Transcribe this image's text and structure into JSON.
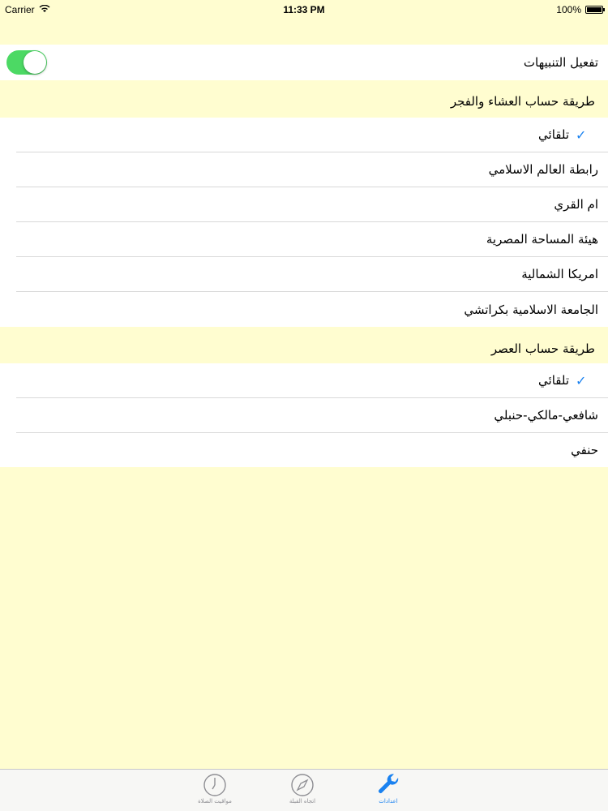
{
  "status_bar": {
    "carrier": "Carrier",
    "time": "11:33 PM",
    "battery": "100%"
  },
  "notifications": {
    "label": "تفعيل التنبيهات",
    "enabled": true,
    "toggle_color": "#4cd964"
  },
  "isha_fajr_section": {
    "header": "طريقة حساب العشاء والفجر",
    "options": [
      {
        "label": "تلقائي",
        "selected": true
      },
      {
        "label": "رابطة العالم الاسلامي",
        "selected": false
      },
      {
        "label": "ام القري",
        "selected": false
      },
      {
        "label": "هيئة المساحة المصرية",
        "selected": false
      },
      {
        "label": "امريكا الشمالية",
        "selected": false
      },
      {
        "label": "الجامعة الاسلامية بكراتشي",
        "selected": false
      }
    ]
  },
  "asr_section": {
    "header": "طريقة حساب العصر",
    "options": [
      {
        "label": "تلقائي",
        "selected": true
      },
      {
        "label": "شافعي-مالكي-حنبلي",
        "selected": false
      },
      {
        "label": "حنفي",
        "selected": false
      }
    ]
  },
  "check_mark": "✓",
  "tab_bar": {
    "tabs": [
      {
        "label": "مواقيت الصلاة",
        "icon": "clock-icon",
        "active": false
      },
      {
        "label": "اتجاه القبلة",
        "icon": "compass-icon",
        "active": false
      },
      {
        "label": "اعدادات",
        "icon": "wrench-icon",
        "active": true
      }
    ]
  },
  "colors": {
    "background": "#fffdd0",
    "accent": "#1a82f0"
  }
}
